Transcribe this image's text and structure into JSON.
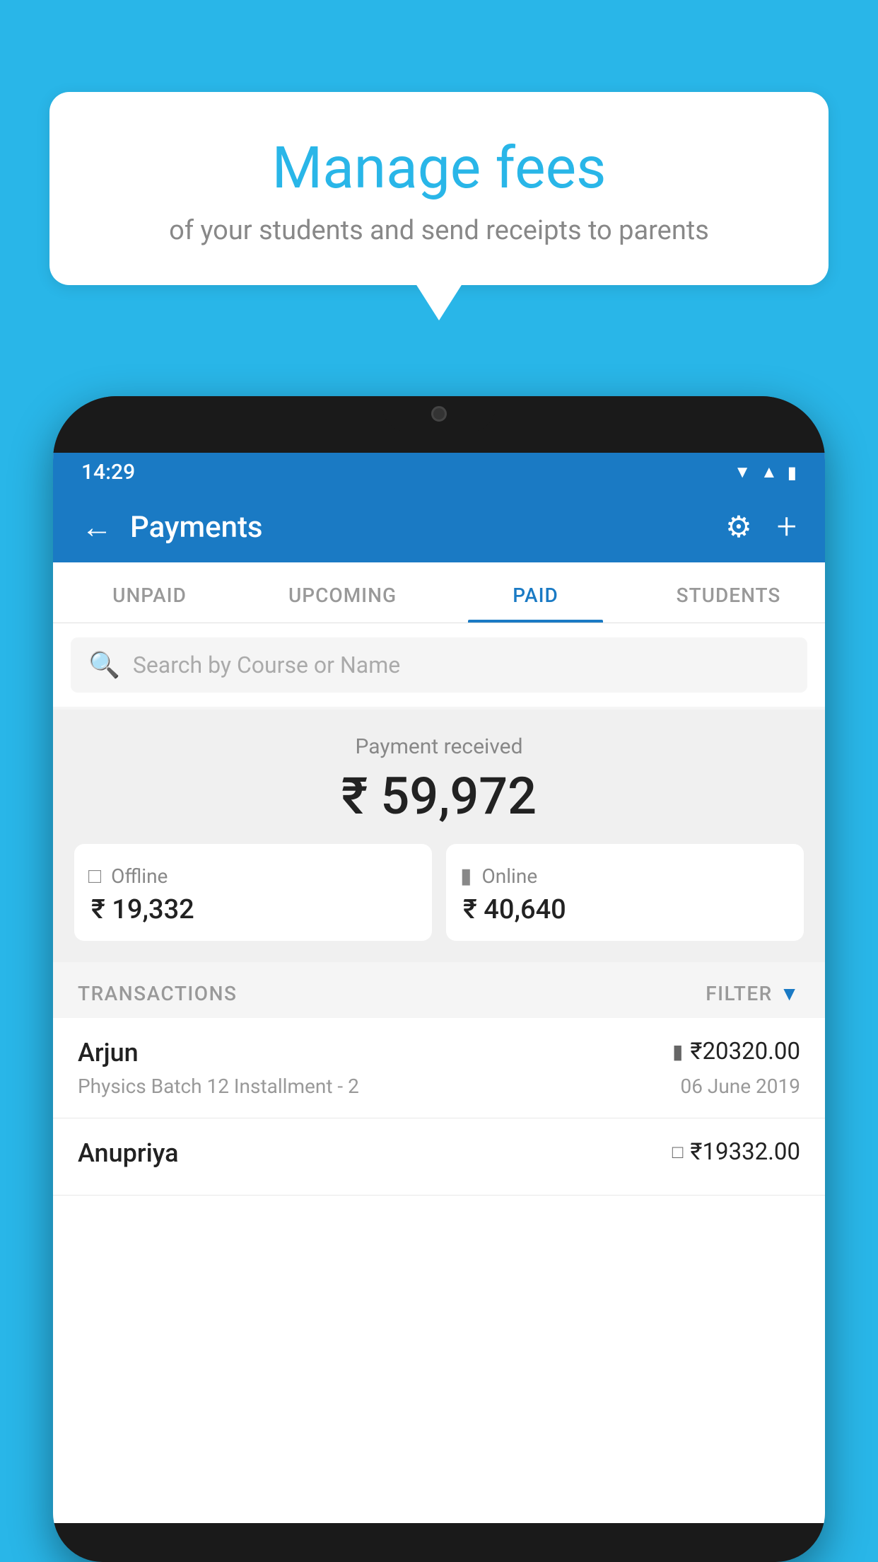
{
  "background_color": "#29b6e8",
  "bubble": {
    "title": "Manage fees",
    "subtitle": "of your students and send receipts to parents"
  },
  "status_bar": {
    "time": "14:29",
    "icons": [
      "wifi",
      "signal",
      "battery"
    ]
  },
  "header": {
    "title": "Payments",
    "back_label": "←",
    "settings_label": "⚙",
    "add_label": "+"
  },
  "tabs": [
    {
      "label": "UNPAID",
      "active": false
    },
    {
      "label": "UPCOMING",
      "active": false
    },
    {
      "label": "PAID",
      "active": true
    },
    {
      "label": "STUDENTS",
      "active": false
    }
  ],
  "search": {
    "placeholder": "Search by Course or Name"
  },
  "payment_summary": {
    "label": "Payment received",
    "amount": "₹ 59,972",
    "offline_label": "Offline",
    "offline_amount": "₹ 19,332",
    "online_label": "Online",
    "online_amount": "₹ 40,640"
  },
  "transactions_section": {
    "label": "TRANSACTIONS",
    "filter_label": "FILTER"
  },
  "transactions": [
    {
      "name": "Arjun",
      "description": "Physics Batch 12 Installment - 2",
      "amount": "₹20320.00",
      "date": "06 June 2019",
      "payment_type": "card"
    },
    {
      "name": "Anupriya",
      "description": "",
      "amount": "₹19332.00",
      "date": "",
      "payment_type": "offline"
    }
  ]
}
